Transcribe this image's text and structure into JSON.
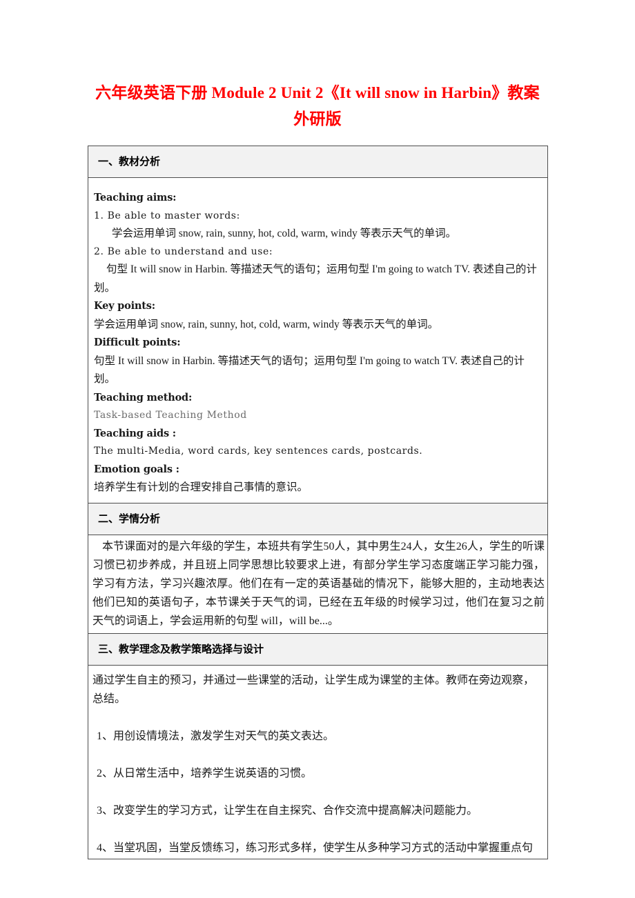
{
  "title": {
    "line1": "六年级英语下册 Module 2 Unit 2《It will snow in Harbin》教案",
    "line2": "外研版",
    "color": "#ff0000"
  },
  "sections": [
    {
      "id": "teaching-material-analysis",
      "heading": "一、教材分析",
      "lines": [
        {
          "label": "Teaching aims:",
          "style": "bold"
        },
        {
          "text": "1. Be able to master words:",
          "style": "en"
        },
        {
          "text": "学会运用单词 snow, rain, sunny, hot, cold, warm, windy 等表示天气的单词。",
          "style": "mixed-indent"
        },
        {
          "text": "2. Be able to understand and use:",
          "style": "en"
        },
        {
          "text": "句型 It will snow in Harbin. 等描述天气的语句；运用句型 I'm going to watch TV. 表述自己的计划。",
          "style": "mixed-wrap-indent"
        },
        {
          "label": "Key points:",
          "style": "bold"
        },
        {
          "text": "学会运用单词 snow, rain, sunny, hot, cold, warm, windy 等表示天气的单词。",
          "style": "mixed"
        },
        {
          "label": "Difficult points:",
          "style": "bold"
        },
        {
          "text": "句型 It will snow in Harbin. 等描述天气的语句；运用句型 I'm going to watch TV. 表述自己的计划。",
          "style": "mixed-wrap"
        },
        {
          "label": "Teaching method:",
          "style": "bold"
        },
        {
          "text": "Task-based Teaching Method",
          "style": "en-faint"
        },
        {
          "label": "Teaching aids :",
          "style": "bold"
        },
        {
          "text": "The multi-Media, word cards, key sentences cards, postcards.",
          "style": "en"
        },
        {
          "label": "Emotion goals :",
          "style": "bold"
        },
        {
          "text": "培养学生有计划的合理安排自己事情的意识。",
          "style": "cn"
        }
      ]
    },
    {
      "id": "student-situation-analysis",
      "heading": "二、学情分析",
      "paragraph": "本节课面对的是六年级的学生，本班共有学生50人，其中男生24人，女生26人，学生的听课习惯已初步养成，并且班上同学思想比较要求上进，有部分学生学习态度端正学习能力强，学习有方法，学习兴趣浓厚。他们在有一定的英语基础的情况下，能够大胆的，主动地表达他们已知的英语句子，本节课关于天气的词，已经在五年级的时候学习过，他们在复习之前天气的词语上，学会运用新的句型 will，will be...。"
    },
    {
      "id": "teaching-philosophy-and-strategy",
      "heading": "三、教学理念及教学策略选择与设计",
      "intro": "通过学生自主的预习，并通过一些课堂的活动，让学生成为课堂的主体。教师在旁边观察，总结。",
      "items": [
        "1、用创设情境法，激发学生对天气的英文表达。",
        "2、从日常生活中，培养学生说英语的习惯。",
        "3、改变学生的学习方式，让学生在自主探究、合作交流中提高解决问题能力。",
        "4、当堂巩固，当堂反馈练习，练习形式多样，使学生从多种学习方式的活动中掌握重点句"
      ]
    }
  ]
}
